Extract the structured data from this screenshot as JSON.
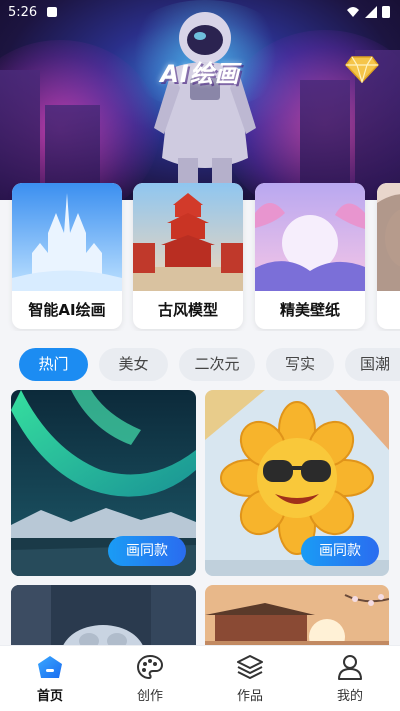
{
  "status_bar": {
    "time": "5:26"
  },
  "hero": {
    "title": "AI绘画",
    "vip_icon": "diamond-icon"
  },
  "categories": [
    {
      "label": "智能AI绘画"
    },
    {
      "label": "古风模型"
    },
    {
      "label": "精美壁纸"
    }
  ],
  "tabs": [
    "热门",
    "美女",
    "二次元",
    "写实",
    "国潮"
  ],
  "active_tab": "热门",
  "gallery": {
    "button_label": "画同款"
  },
  "nav": [
    {
      "label": "首页",
      "icon": "home-icon"
    },
    {
      "label": "创作",
      "icon": "palette-icon"
    },
    {
      "label": "作品",
      "icon": "layers-icon"
    },
    {
      "label": "我的",
      "icon": "user-icon"
    }
  ],
  "colors": {
    "accent": "#1c8cf2",
    "tab_bg": "#e9ecf1",
    "page_bg": "#f4f5f8"
  }
}
